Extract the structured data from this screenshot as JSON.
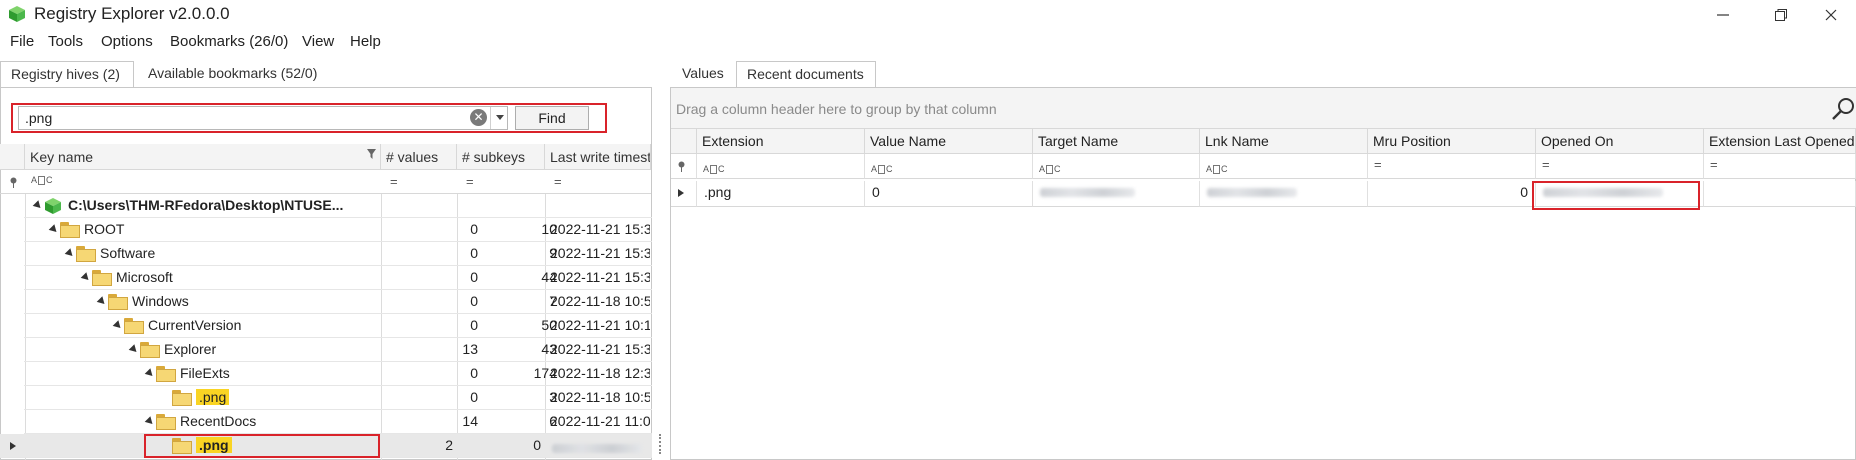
{
  "window": {
    "title": "Registry Explorer v2.0.0.0"
  },
  "menu": [
    "File",
    "Tools",
    "Options",
    "Bookmarks (26/0)",
    "View",
    "Help"
  ],
  "left_tabs": [
    "Registry hives (2)",
    "Available bookmarks (52/0)"
  ],
  "search": {
    "value": ".png",
    "find_label": "Find"
  },
  "tree_columns": [
    "Key name",
    "# values",
    "# subkeys",
    "Last write timestamp"
  ],
  "tree_rows": [
    {
      "name": "C:\\Users\\THM-RFedora\\Desktop\\NTUSE...",
      "values": "",
      "subkeys": "",
      "timestamp": ""
    },
    {
      "name": "ROOT",
      "values": "0",
      "subkeys": "10",
      "timestamp": "2022-11-21 15:3"
    },
    {
      "name": "Software",
      "values": "0",
      "subkeys": "9",
      "timestamp": "2022-11-21 15:3"
    },
    {
      "name": "Microsoft",
      "values": "0",
      "subkeys": "44",
      "timestamp": "2022-11-21 15:3"
    },
    {
      "name": "Windows",
      "values": "0",
      "subkeys": "7",
      "timestamp": "2022-11-18 10:5"
    },
    {
      "name": "CurrentVersion",
      "values": "0",
      "subkeys": "50",
      "timestamp": "2022-11-21 10:1"
    },
    {
      "name": "Explorer",
      "values": "13",
      "subkeys": "43",
      "timestamp": "2022-11-21 15:3"
    },
    {
      "name": "FileExts",
      "values": "0",
      "subkeys": "174",
      "timestamp": "2022-11-18 12:3"
    },
    {
      "name": ".png",
      "values": "0",
      "subkeys": "3",
      "timestamp": "2022-11-18 10:5"
    },
    {
      "name": "RecentDocs",
      "values": "14",
      "subkeys": "6",
      "timestamp": "2022-11-21 11:0"
    },
    {
      "name": ".png",
      "values": "2",
      "subkeys": "0",
      "timestamp": ""
    }
  ],
  "right_tabs": [
    "Values",
    "Recent documents"
  ],
  "group_hint": "Drag a column header here to group by that column",
  "doc_columns": [
    "Extension",
    "Value Name",
    "Target Name",
    "Lnk Name",
    "Mru Position",
    "Opened On",
    "Extension Last Opened"
  ],
  "doc_row": {
    "extension": ".png",
    "value_name": "0",
    "target_name": "",
    "lnk_name": "",
    "mru_position": "0",
    "opened_on": "",
    "extension_last_opened": ""
  },
  "colors": {
    "highlight_red": "#d9232a",
    "match_yellow": "#f9d423",
    "folder": "#f6d774"
  }
}
